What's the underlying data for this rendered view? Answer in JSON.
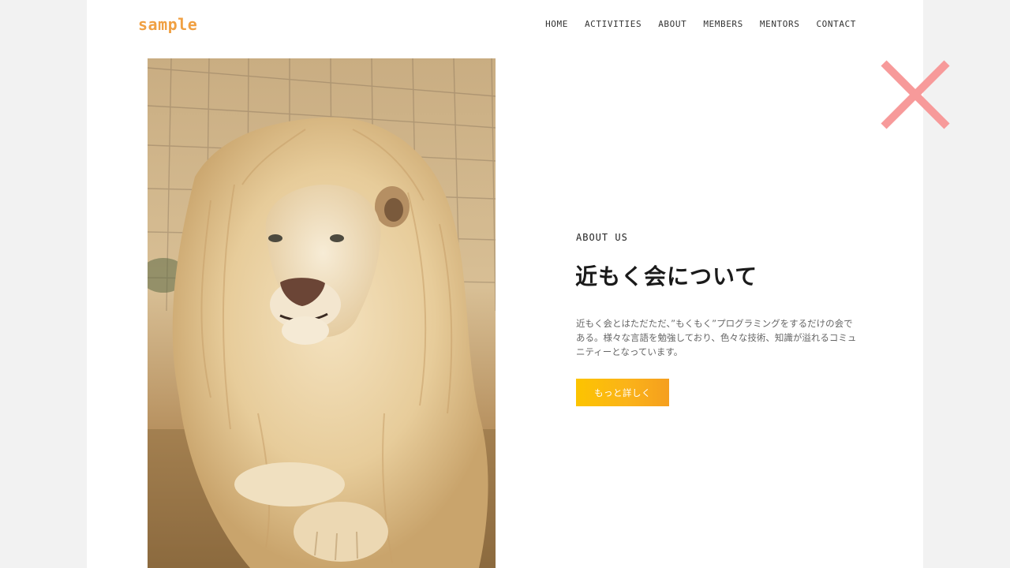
{
  "brand": {
    "logo_text": "sample",
    "logo_color": "#f0a042"
  },
  "nav": {
    "items": [
      {
        "label": "HOME"
      },
      {
        "label": "ACTIVITIES"
      },
      {
        "label": "ABOUT"
      },
      {
        "label": "MEMBERS"
      },
      {
        "label": "MENTORS"
      },
      {
        "label": "CONTACT"
      }
    ]
  },
  "hero_image": {
    "subject": "white lion lying on dry grass"
  },
  "about": {
    "eyebrow": "ABOUT US",
    "title": "近もく会について",
    "body": "近もく会とはただただ、”もくもく”プログラミングをするだけの会である。様々な言語を勉強しており、色々な技術、知識が溢れるコミュニティーとなっています。",
    "button_label": "もっと詳しく",
    "button_colors": [
      "#fcc400",
      "#f59f1e"
    ]
  },
  "close_icon": {
    "icon": "close-icon",
    "color": "#f79a9a"
  }
}
